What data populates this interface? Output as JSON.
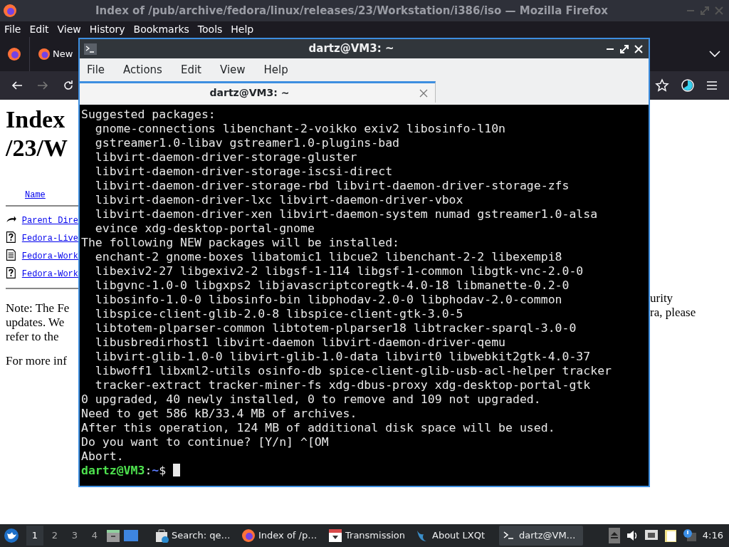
{
  "browser": {
    "title": "Index of /pub/archive/fedora/linux/releases/23/Workstation/i386/iso — Mozilla Firefox",
    "menu": [
      "File",
      "Edit",
      "View",
      "History",
      "Bookmarks",
      "Tools",
      "Help"
    ],
    "tabs": [
      {
        "label": "New",
        "selected": false
      }
    ],
    "page": {
      "heading_lines": [
        "Index",
        "/23/W"
      ],
      "column_header": "Name",
      "entries": [
        {
          "kind": "parent",
          "name": "Parent Dire"
        },
        {
          "kind": "unknown",
          "name": "Fedora-Live"
        },
        {
          "kind": "text",
          "name": "Fedora-Work"
        },
        {
          "kind": "unknown",
          "name": "Fedora-Work"
        }
      ],
      "note_lines_left": [
        "Note: The Fe",
        "updates. We",
        "refer to the"
      ],
      "note_lines_right": [
        "urity",
        "ra, please"
      ],
      "more_info": "For more inf"
    }
  },
  "terminal": {
    "title": "dartz@VM3: ~",
    "menu": [
      "File",
      "Actions",
      "Edit",
      "View",
      "Help"
    ],
    "tabs": [
      {
        "label": "dartz@VM3: ~",
        "selected": true
      }
    ],
    "lines": [
      "Suggested packages:",
      "  gnome-connections libenchant-2-voikko exiv2 libosinfo-l10n",
      "  gstreamer1.0-libav gstreamer1.0-plugins-bad",
      "  libvirt-daemon-driver-storage-gluster",
      "  libvirt-daemon-driver-storage-iscsi-direct",
      "  libvirt-daemon-driver-storage-rbd libvirt-daemon-driver-storage-zfs",
      "  libvirt-daemon-driver-lxc libvirt-daemon-driver-vbox",
      "  libvirt-daemon-driver-xen libvirt-daemon-system numad gstreamer1.0-alsa",
      "  evince xdg-desktop-portal-gnome",
      "The following NEW packages will be installed:",
      "  enchant-2 gnome-boxes libatomic1 libcue2 libenchant-2-2 libexempi8",
      "  libexiv2-27 libgexiv2-2 libgsf-1-114 libgsf-1-common libgtk-vnc-2.0-0",
      "  libgvnc-1.0-0 libgxps2 libjavascriptcoregtk-4.0-18 libmanette-0.2-0",
      "  libosinfo-1.0-0 libosinfo-bin libphodav-2.0-0 libphodav-2.0-common",
      "  libspice-client-glib-2.0-8 libspice-client-gtk-3.0-5",
      "  libtotem-plparser-common libtotem-plparser18 libtracker-sparql-3.0-0",
      "  libusbredirhost1 libvirt-daemon libvirt-daemon-driver-qemu",
      "  libvirt-glib-1.0-0 libvirt-glib-1.0-data libvirt0 libwebkit2gtk-4.0-37",
      "  libwoff1 libxml2-utils osinfo-db spice-client-glib-usb-acl-helper tracker",
      "  tracker-extract tracker-miner-fs xdg-dbus-proxy xdg-desktop-portal-gtk",
      "0 upgraded, 40 newly installed, 0 to remove and 109 not upgraded.",
      "Need to get 586 kB/33.4 MB of archives.",
      "After this operation, 124 MB of additional disk space will be used.",
      "Do you want to continue? [Y/n] ^[OM",
      "Abort."
    ],
    "prompt": {
      "user_host": "dartz@VM3",
      "separator": ":",
      "path": "~",
      "symbol": "$"
    }
  },
  "taskbar": {
    "desktops": [
      {
        "label": "1",
        "selected": true
      },
      {
        "label": "2",
        "selected": false
      },
      {
        "label": "3",
        "selected": false
      },
      {
        "label": "4",
        "selected": false
      }
    ],
    "tasks": [
      {
        "kind": "search",
        "label": "Search: qe…",
        "selected": false
      },
      {
        "kind": "browser",
        "label": "Index of /p…",
        "selected": false
      },
      {
        "kind": "torrent",
        "label": "Transmission",
        "selected": false
      },
      {
        "kind": "about",
        "label": "About LXQt",
        "selected": false
      },
      {
        "kind": "terminal",
        "label": "dartz@VM…",
        "selected": true
      }
    ],
    "clock": "4:16"
  }
}
